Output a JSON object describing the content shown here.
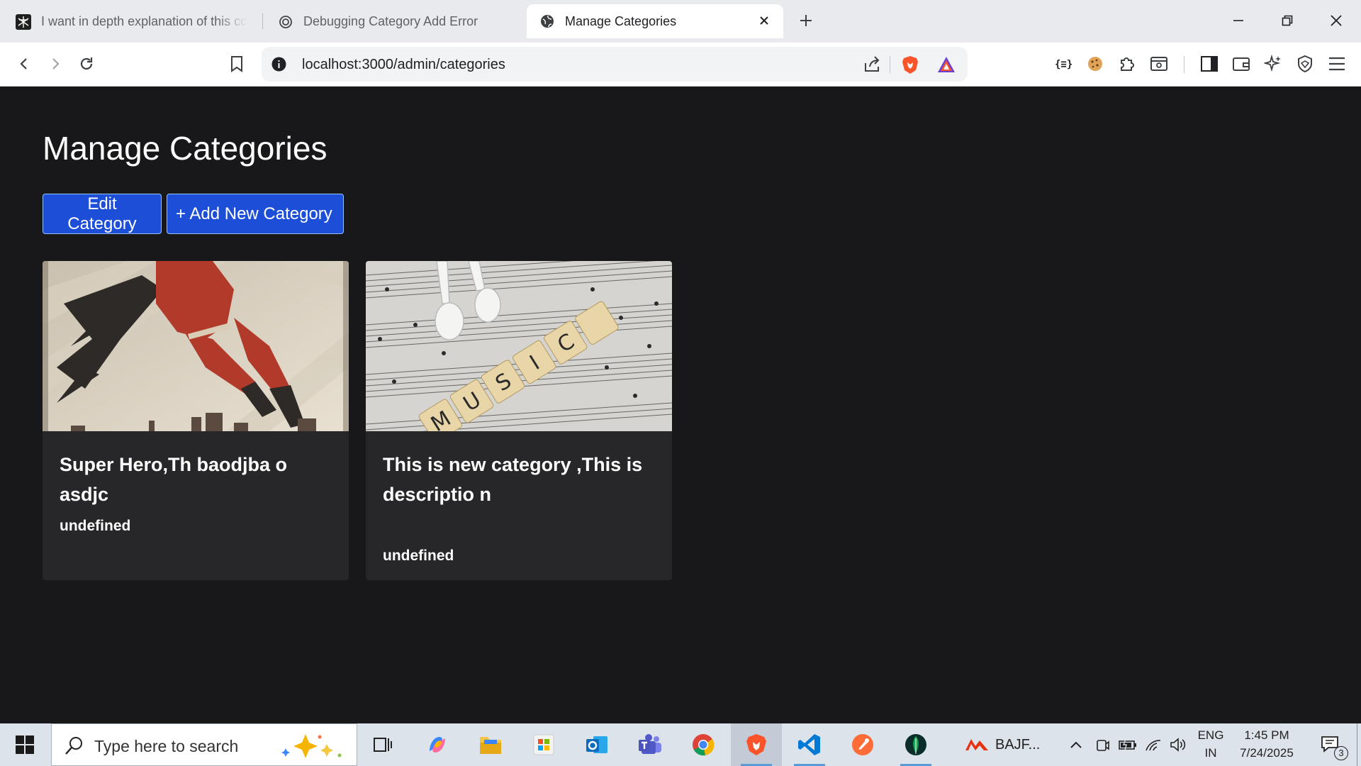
{
  "browser": {
    "tabs": [
      {
        "title": "I want in depth explanation of this co"
      },
      {
        "title": "Debugging Category Add Error"
      },
      {
        "title": "Manage Categories"
      }
    ],
    "url": "localhost:3000/admin/categories"
  },
  "page": {
    "title": "Manage Categories",
    "buttons": {
      "edit": "Edit Category",
      "add": "+ Add New Category"
    },
    "cards": [
      {
        "title": "Super Hero,Th baodjba o asdjc",
        "description": "undefined",
        "image": "superhero-illustration"
      },
      {
        "title": "This is new category ,This is descriptio n",
        "description": "undefined",
        "image": "music-scrabble-earphones"
      }
    ]
  },
  "taskbar": {
    "search_placeholder": "Type here to search",
    "bajaj_label": "BAJF...",
    "language": "ENG",
    "region": "IN",
    "time": "1:45 PM",
    "date": "7/24/2025",
    "notification_count": "3"
  },
  "colors": {
    "page_bg": "#18181b",
    "card_bg": "#27272a",
    "button_bg": "#1d4ed8",
    "brave_orange": "#fb542b"
  }
}
